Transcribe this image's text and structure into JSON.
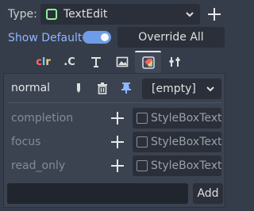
{
  "type_row": {
    "label": "Type:",
    "value": "TextEdit",
    "node_icon": "textedit-node-icon",
    "dropdown_icon": "chevron-down-icon",
    "add_icon": "plus-icon"
  },
  "show_default": {
    "label": "Show Default",
    "toggle_on": true
  },
  "override_all_label": "Override All",
  "tabs": [
    {
      "name": "tab-colors",
      "label": "clr",
      "active": false
    },
    {
      "name": "tab-constants",
      "label": ".c",
      "active": false
    },
    {
      "name": "tab-fonts",
      "label": "T",
      "active": false
    },
    {
      "name": "tab-icons",
      "label": "image-icon",
      "active": false
    },
    {
      "name": "tab-styleboxes",
      "label": "stylebox-icon",
      "active": true
    },
    {
      "name": "tab-tools",
      "label": "tools-icon",
      "active": false
    }
  ],
  "style_rows": {
    "normal": {
      "label": "normal",
      "value": "[empty]"
    },
    "completion": {
      "label": "completion",
      "value": "StyleBoxText"
    },
    "focus": {
      "label": "focus",
      "value": "StyleBoxText"
    },
    "read_only": {
      "label": "read_only",
      "value": "StyleBoxText"
    }
  },
  "add_label": "Add",
  "colors": {
    "background": "#363d4a",
    "accent": "#6e9ce8",
    "node_green": "#8eef97",
    "pin_blue": "#8fb6ff"
  }
}
